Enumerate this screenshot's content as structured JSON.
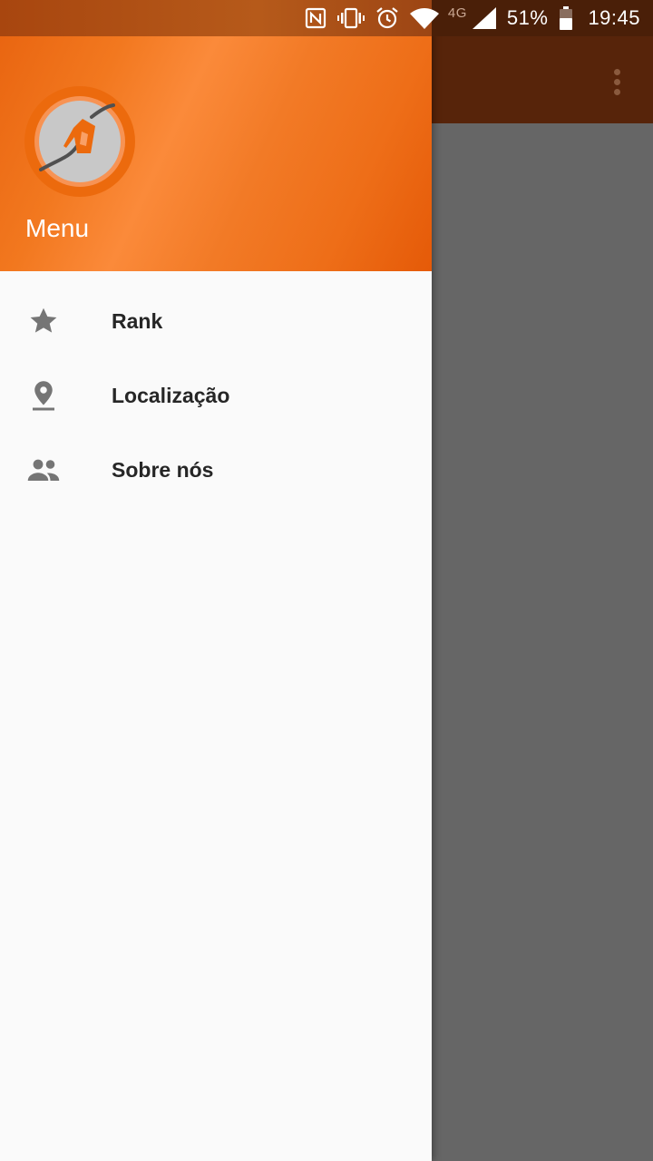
{
  "status_bar": {
    "icons": [
      "nfc-icon",
      "vibrate-icon",
      "alarm-icon",
      "wifi-icon",
      "signal-icon",
      "battery-icon"
    ],
    "network_type": "4G",
    "battery": "51%",
    "time": "19:45"
  },
  "toolbar": {
    "overflow_icon": "more-vert-icon"
  },
  "drawer": {
    "title": "Menu",
    "logo_icon": "fuel-pump-icon",
    "items": [
      {
        "label": "Rank",
        "icon": "star-icon"
      },
      {
        "label": "Localização",
        "icon": "location-pin-icon"
      },
      {
        "label": "Sobre nós",
        "icon": "people-icon"
      }
    ]
  },
  "colors": {
    "header_orange": "#f2781f",
    "toolbar_brown": "#57240a",
    "scrim_gray": "#666666",
    "drawer_bg": "#fafafa",
    "icon_gray": "#757575"
  }
}
